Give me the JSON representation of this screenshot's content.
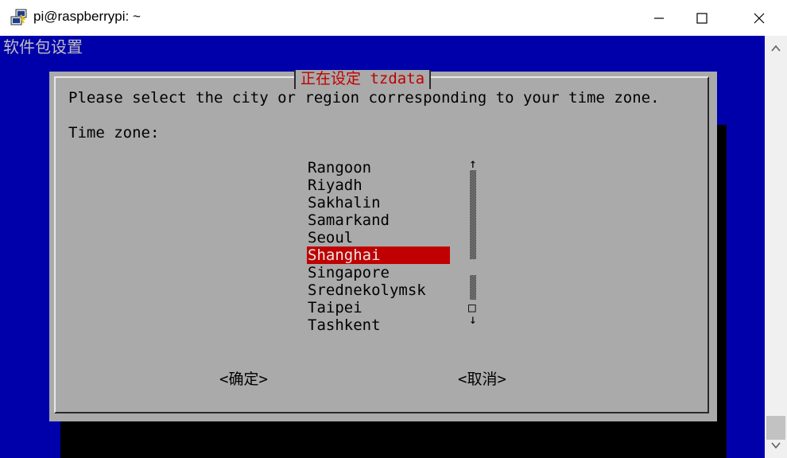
{
  "window": {
    "title": "pi@raspberrypi: ~",
    "icons": {
      "app": "putty-icon",
      "minimize": "minimize-icon",
      "maximize": "maximize-icon",
      "close": "close-icon"
    }
  },
  "terminal": {
    "backtitle": "软件包设置",
    "colors": {
      "background": "#0000aa",
      "dialog": "#aaaaaa",
      "highlight": "#c00000",
      "shadow": "#000000"
    }
  },
  "dialog": {
    "title": "正在设定 tzdata",
    "prompt": "Please select the city or region corresponding to your time zone.",
    "field_label": "Time zone:",
    "items": [
      "Rangoon",
      "Riyadh",
      "Sakhalin",
      "Samarkand",
      "Seoul",
      "Shanghai",
      "Singapore",
      "Srednekolymsk",
      "Taipei",
      "Tashkent"
    ],
    "selected_index": 5,
    "scroll": {
      "up": "↑",
      "down": "↓",
      "mark": "□"
    },
    "buttons": {
      "ok": "<确定>",
      "cancel": "<取消>"
    }
  }
}
